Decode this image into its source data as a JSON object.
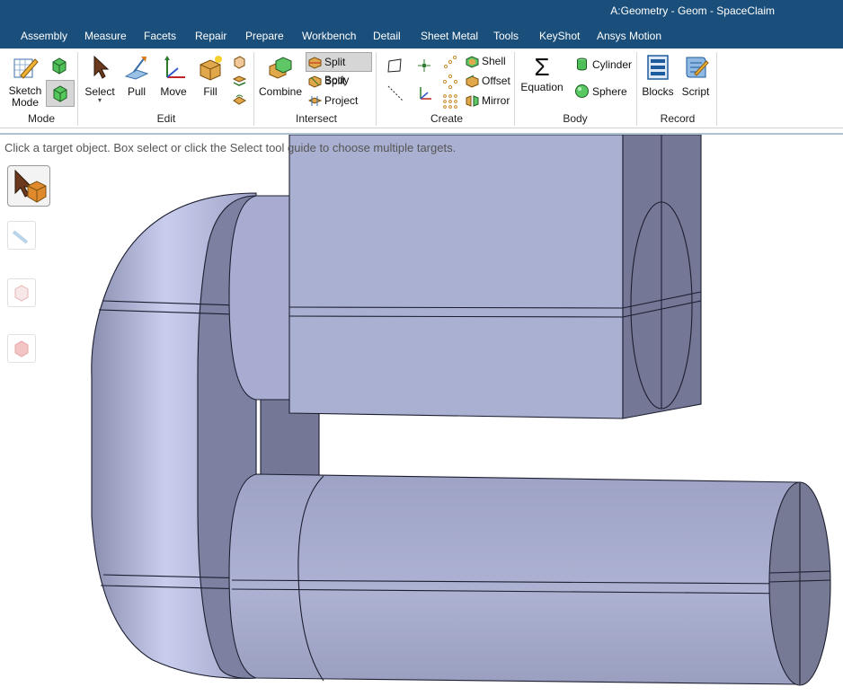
{
  "window": {
    "title": "A:Geometry - Geom - SpaceClaim"
  },
  "menu": [
    "Assembly",
    "Measure",
    "Facets",
    "Repair",
    "Prepare",
    "Workbench",
    "Detail",
    "Sheet Metal",
    "Tools",
    "KeyShot",
    "Ansys Motion"
  ],
  "ribbon": {
    "mode": {
      "label": "Mode",
      "sketch": "Sketch\nMode"
    },
    "edit": {
      "label": "Edit",
      "select": "Select",
      "pull": "Pull",
      "move": "Move",
      "fill": "Fill"
    },
    "intersect": {
      "label": "Intersect",
      "combine": "Combine",
      "split_body": "Split Body",
      "split": "Split",
      "project": "Project"
    },
    "create": {
      "label": "Create",
      "shell": "Shell",
      "offset": "Offset",
      "mirror": "Mirror"
    },
    "body": {
      "label": "Body",
      "equation": "Equation",
      "cylinder": "Cylinder",
      "sphere": "Sphere"
    },
    "record": {
      "label": "Record",
      "blocks": "Blocks",
      "script": "Script"
    }
  },
  "status_hint": "Click a target object.  Box select or click the Select tool guide to choose multiple targets.",
  "colors": {
    "titlebar": "#1b4f7b",
    "geometry": "#aab0d1",
    "geometry_dark": "#767a94",
    "edges": "#1c1e30"
  }
}
